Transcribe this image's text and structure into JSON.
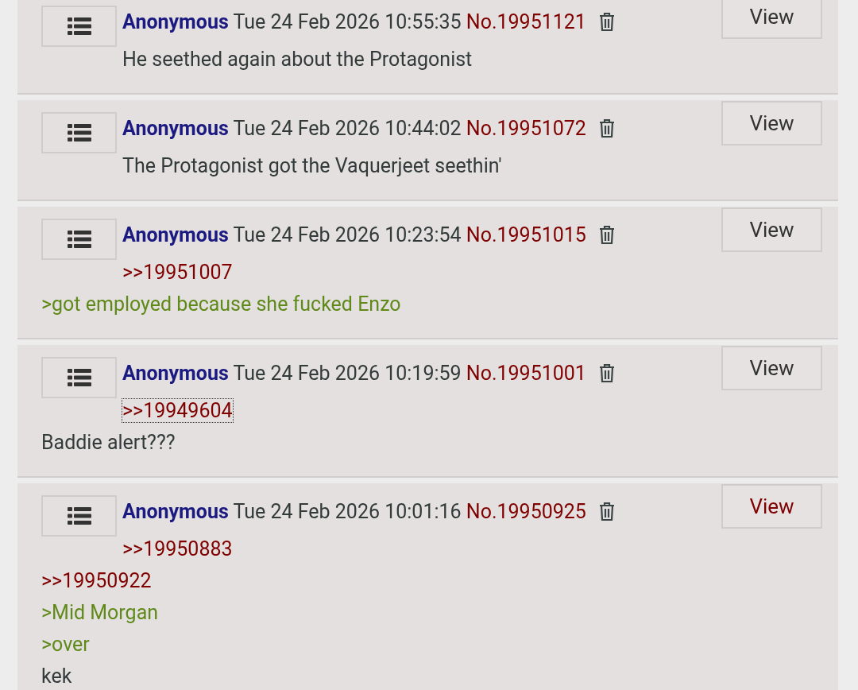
{
  "posts": [
    {
      "name": "Anonymous",
      "date": "Tue 24 Feb 2026 10:55:35",
      "number": "No.19951121",
      "view": {
        "label": "View",
        "highlighted": false
      },
      "lines": [
        {
          "kind": "text",
          "text": "He seethed again about the Protagonist",
          "focused": false
        }
      ]
    },
    {
      "name": "Anonymous",
      "date": "Tue 24 Feb 2026 10:44:02",
      "number": "No.19951072",
      "view": {
        "label": "View",
        "highlighted": false
      },
      "lines": [
        {
          "kind": "text",
          "text": "The Protagonist got the Vaquerjeet seethin'",
          "focused": false
        }
      ]
    },
    {
      "name": "Anonymous",
      "date": "Tue 24 Feb 2026 10:23:54",
      "number": "No.19951015",
      "view": {
        "label": "View",
        "highlighted": false
      },
      "lines": [
        {
          "kind": "quote",
          "text": ">>19951007",
          "focused": false
        },
        {
          "kind": "greentext",
          "text": ">got employed because she fucked Enzo",
          "focused": false
        }
      ]
    },
    {
      "name": "Anonymous",
      "date": "Tue 24 Feb 2026 10:19:59",
      "number": "No.19951001",
      "view": {
        "label": "View",
        "highlighted": false
      },
      "lines": [
        {
          "kind": "quote",
          "text": ">>19949604",
          "focused": true
        },
        {
          "kind": "text",
          "text": "Baddie alert???",
          "focused": false
        }
      ]
    },
    {
      "name": "Anonymous",
      "date": "Tue 24 Feb 2026 10:01:16",
      "number": "No.19950925",
      "view": {
        "label": "View",
        "highlighted": true
      },
      "lines": [
        {
          "kind": "quote",
          "text": ">>19950883",
          "focused": false
        },
        {
          "kind": "quote",
          "text": ">>19950922",
          "focused": false
        },
        {
          "kind": "greentext",
          "text": ">Mid Morgan",
          "focused": false
        },
        {
          "kind": "greentext",
          "text": ">over",
          "focused": false
        },
        {
          "kind": "text",
          "text": "kek",
          "focused": false
        }
      ]
    }
  ]
}
